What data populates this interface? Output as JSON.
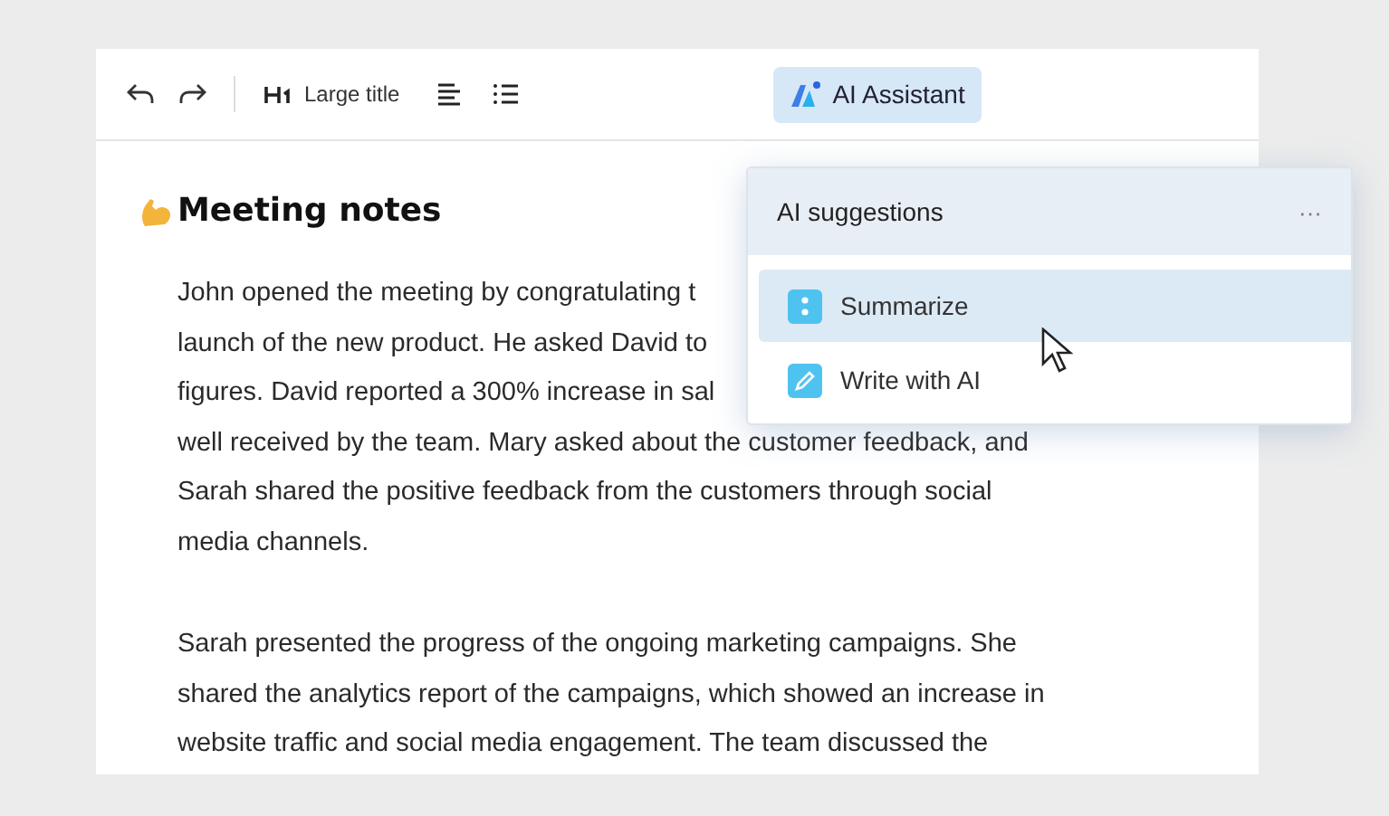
{
  "toolbar": {
    "heading_label": "Large title",
    "ai_button": {
      "label": "AI Assistant",
      "selected": true
    }
  },
  "document": {
    "title": "Meeting notes",
    "paragraphs": [
      {
        "lines": [
          "John opened the meeting by congratulating t",
          "launch of the new product. He asked David to",
          "figures. David reported a 300% increase in sal",
          "well received by the team. Mary asked about the customer feedback, and",
          "Sarah shared the positive feedback from the customers through social",
          "media channels."
        ]
      },
      {
        "lines": [
          "Sarah presented the progress of the ongoing marketing campaigns. She",
          "shared the analytics report of the campaigns, which showed an increase in",
          "website traffic and social media engagement. The team discussed the"
        ]
      }
    ]
  },
  "popup": {
    "title": "AI suggestions",
    "more": "···",
    "items": [
      {
        "label": "Summarize",
        "kind": "summarize",
        "selected": true
      },
      {
        "label": "Write with AI",
        "kind": "write",
        "selected": false
      }
    ]
  }
}
